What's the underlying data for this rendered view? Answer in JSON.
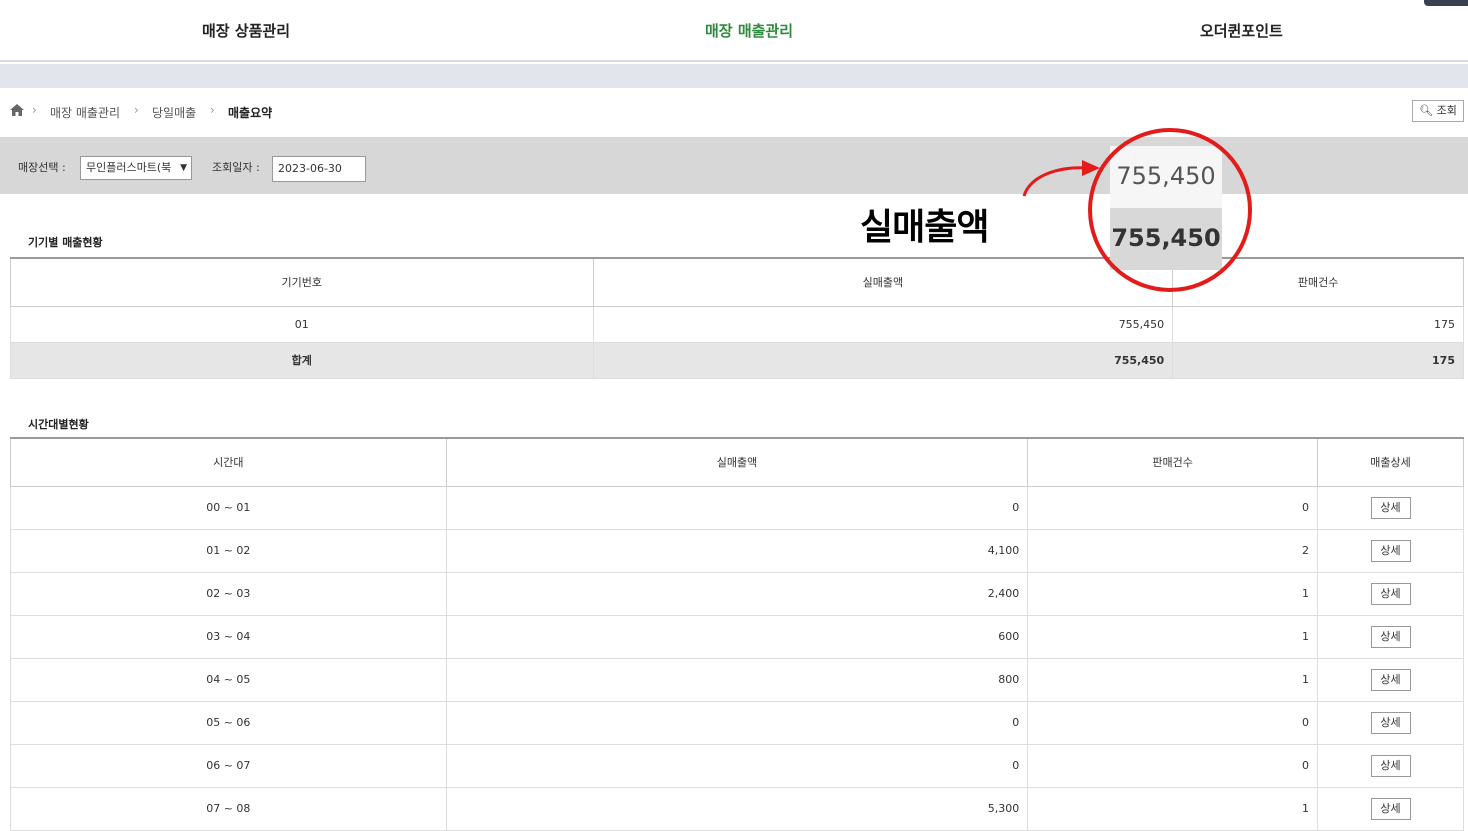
{
  "topnav": {
    "items": [
      "매장 상품관리",
      "매장 매출관리",
      "오더퀸포인트"
    ]
  },
  "breadcrumb": {
    "items": [
      "매장 매출관리",
      "당일매출",
      "매출요약"
    ],
    "separator": "›"
  },
  "toolbar": {
    "query_label": "조회"
  },
  "filters": {
    "store_label": "매장선택 :",
    "store_value": "무인플러스마트(북",
    "date_label": "조회일자 :",
    "date_value": "2023-06-30"
  },
  "device_table": {
    "title": "기기별 매출현황",
    "headers": [
      "기기번호",
      "실매출액",
      "판매건수"
    ],
    "rows": [
      [
        "01",
        "755,450",
        "175"
      ]
    ],
    "total": [
      "합계",
      "755,450",
      "175"
    ]
  },
  "time_table": {
    "title": "시간대별현황",
    "headers": [
      "시간대",
      "실매출액",
      "판매건수",
      "매출상세"
    ],
    "detail_label": "상세",
    "rows": [
      [
        "00 ~ 01",
        "0",
        "0"
      ],
      [
        "01 ~ 02",
        "4,100",
        "2"
      ],
      [
        "02 ~ 03",
        "2,400",
        "1"
      ],
      [
        "03 ~ 04",
        "600",
        "1"
      ],
      [
        "04 ~ 05",
        "800",
        "1"
      ],
      [
        "05 ~ 06",
        "0",
        "0"
      ],
      [
        "06 ~ 07",
        "0",
        "0"
      ],
      [
        "07 ~ 08",
        "5,300",
        "1"
      ]
    ]
  },
  "annotation": {
    "label": "실매출액",
    "zoom_top": "755,450",
    "zoom_bottom": "755,450",
    "highlight_color": "#e41b1b"
  }
}
